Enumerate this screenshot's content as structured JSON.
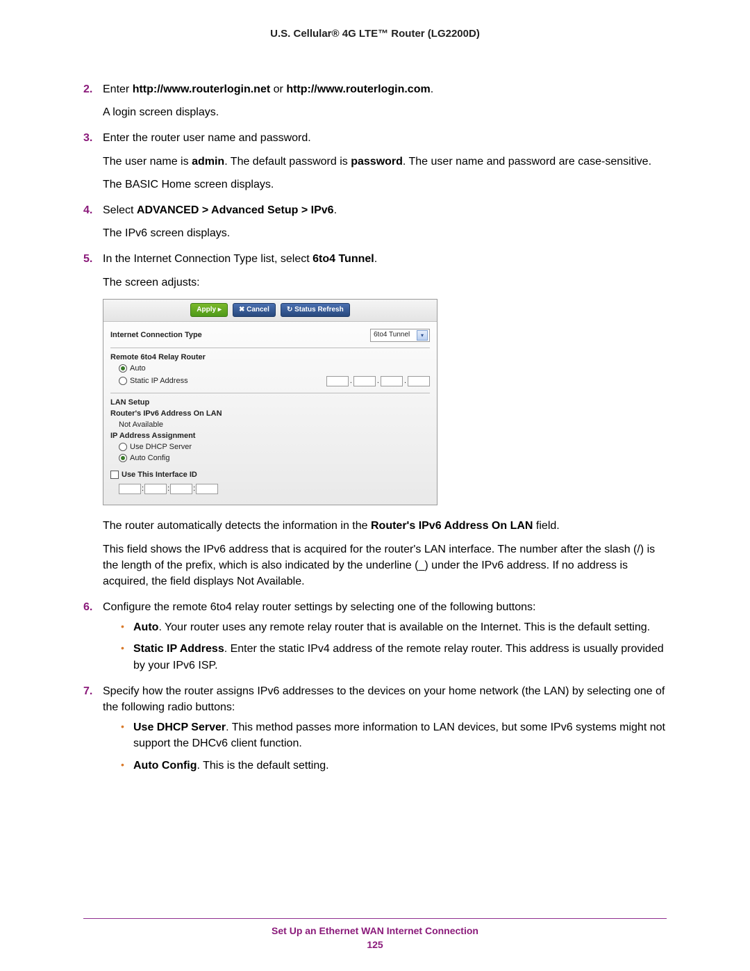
{
  "header": {
    "title": "U.S. Cellular® 4G LTE™ Router (LG2200D)"
  },
  "steps": {
    "s2": {
      "num": "2.",
      "t1": "Enter ",
      "b1": "http://www.routerlogin.net",
      "t2": " or ",
      "b2": "http://www.routerlogin.com",
      "t3": ".",
      "p1": "A login screen displays."
    },
    "s3": {
      "num": "3.",
      "t1": "Enter the router user name and password.",
      "p1a": "The user name is ",
      "p1b": "admin",
      "p1c": ". The default password is ",
      "p1d": "password",
      "p1e": ". The user name and password are case-sensitive.",
      "p2": "The BASIC Home screen displays."
    },
    "s4": {
      "num": "4.",
      "t1": "Select ",
      "b1": "ADVANCED > Advanced Setup > IPv6",
      "t2": ".",
      "p1": "The IPv6 screen displays."
    },
    "s5": {
      "num": "5.",
      "t1": "In the Internet Connection Type list, select ",
      "b1": "6to4 Tunnel",
      "t2": ".",
      "p1": "The screen adjusts:",
      "p2a": "The router automatically detects the information in the ",
      "p2b": "Router's IPv6 Address On LAN",
      "p2c": " field.",
      "p3": "This field shows the IPv6 address that is acquired for the router's LAN interface. The number after the slash (/) is the length of the prefix, which is also indicated by the underline (_) under the IPv6 address. If no address is acquired, the field displays Not Available."
    },
    "s6": {
      "num": "6.",
      "t1": "Configure the remote 6to4 relay router settings by selecting one of the following buttons:",
      "li1b": "Auto",
      "li1t": ". Your router uses any remote relay router that is available on the Internet. This is the default setting.",
      "li2b": "Static IP Address",
      "li2t": ". Enter the static IPv4 address of the remote relay router. This address is usually provided by your IPv6 ISP."
    },
    "s7": {
      "num": "7.",
      "t1": "Specify how the router assigns IPv6 addresses to the devices on your home network (the LAN) by selecting one of the following radio buttons:",
      "li1b": "Use DHCP Server",
      "li1t": ". This method passes more information to LAN devices, but some IPv6 systems might not support the DHCv6 client function.",
      "li2b": "Auto Config",
      "li2t": ". This is the default setting."
    }
  },
  "ss": {
    "apply": "Apply ▸",
    "cancel": "✖ Cancel",
    "refresh": "↻ Status Refresh",
    "ict_label": "Internet Connection Type",
    "ict_value": "6to4 Tunnel",
    "relay_label": "Remote 6to4 Relay Router",
    "auto": "Auto",
    "static": "Static IP Address",
    "lan_setup": "LAN Setup",
    "router_addr": "Router's IPv6 Address On LAN",
    "not_available": "Not Available",
    "ip_assign": "IP Address Assignment",
    "use_dhcp": "Use DHCP Server",
    "auto_config": "Auto Config",
    "use_interface": "Use This Interface ID"
  },
  "footer": {
    "title": "Set Up an Ethernet WAN Internet Connection",
    "page": "125"
  }
}
